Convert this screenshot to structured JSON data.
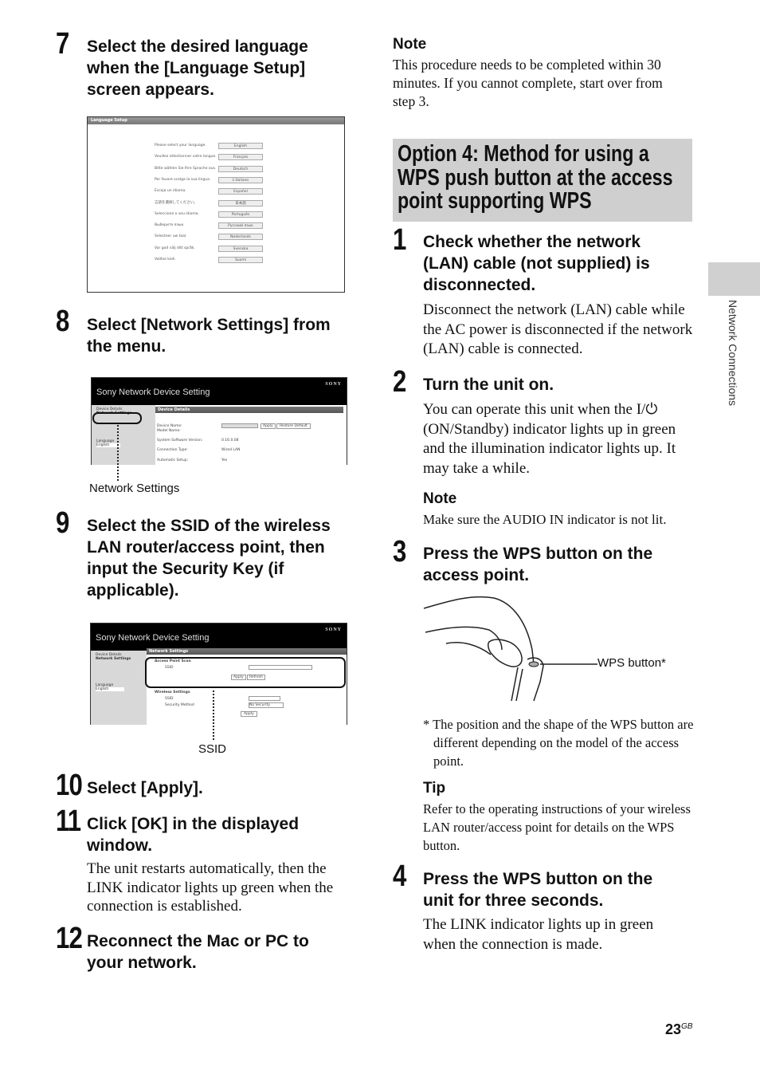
{
  "left": {
    "step7": {
      "num": "7",
      "heading": "Select the desired language when the [Language Setup] screen appears."
    },
    "language_screen": {
      "title": "Language Setup",
      "rows": [
        {
          "prompt": "Please select your language.",
          "button": "English"
        },
        {
          "prompt": "Veuillez sélectionner votre langue.",
          "button": "Français"
        },
        {
          "prompt": "Bitte wählen Sie Ihre Sprache aus.",
          "button": "Deutsch"
        },
        {
          "prompt": "Per favore scelga la sua lingua.",
          "button": "L'italiano"
        },
        {
          "prompt": "Escoja un idioma.",
          "button": "Español"
        },
        {
          "prompt": "言語を選択してください。",
          "button": "日本語"
        },
        {
          "prompt": "Seleccione o seu idioma.",
          "button": "Português"
        },
        {
          "prompt": "Выберите язык.",
          "button": "Русский язык"
        },
        {
          "prompt": "Selecteer uw taal.",
          "button": "Nederlands"
        },
        {
          "prompt": "Var god välj ditt språk.",
          "button": "Svenska"
        },
        {
          "prompt": "Valitse kieli.",
          "button": "Suomi"
        }
      ]
    },
    "step8": {
      "num": "8",
      "heading": "Select [Network Settings] from the menu."
    },
    "device_screen": {
      "title": "Sony Network Device Setting",
      "logo": "SONY",
      "menu_device": "Device Details",
      "menu_network": "Network Settings",
      "language_label": "Language",
      "language_value": "English",
      "section": "Device Details",
      "fields": [
        "Device Name:",
        "Model Name:",
        "System Software Version:",
        "Connection Type:",
        "Automatic Setup:"
      ],
      "values": [
        "",
        "",
        "0.16.0.08",
        "Wired LAN",
        "Yes"
      ],
      "apply": "Apply",
      "restore": "Restore Default"
    },
    "callout_network": "Network Settings",
    "step9": {
      "num": "9",
      "heading": "Select the SSID of the wireless LAN router/access point, then input the Security Key (if applicable)."
    },
    "network_screen": {
      "title": "Sony Network Device Setting",
      "logo": "SONY",
      "menu_device": "Device Details",
      "menu_network": "Network Settings",
      "language_label": "Language",
      "language_value": "English",
      "section": "Network Settings",
      "scan_legend": "Access Point Scan",
      "ssid": "SSID",
      "apply": "Apply",
      "refresh": "Refresh",
      "wireless_legend": "Wireless Settings",
      "security": "Security Method",
      "security_value": "No Security"
    },
    "callout_ssid": "SSID",
    "step10": {
      "num": "10",
      "heading": "Select [Apply]."
    },
    "step11": {
      "num": "11",
      "heading": "Click [OK] in the displayed window.",
      "body": "The unit restarts automatically, then the LINK indicator lights up green when the connection is established."
    },
    "step12": {
      "num": "12",
      "heading": "Reconnect the Mac or PC to your network."
    }
  },
  "right": {
    "note1": {
      "title": "Note",
      "body": "This procedure needs to be completed within 30 minutes. If you cannot complete, start over from step 3."
    },
    "option_title": "Option 4: Method for using a WPS push button at the access point supporting WPS",
    "step1": {
      "num": "1",
      "heading": "Check whether the network (LAN) cable (not supplied) is disconnected.",
      "body": "Disconnect the network (LAN) cable while the AC power is disconnected if the network (LAN) cable is connected."
    },
    "step2": {
      "num": "2",
      "heading": "Turn the unit on.",
      "body": "You can operate this unit when the I/⏻ (ON/Standby) indicator lights up in green and the illumination indicator lights up. It may take a while."
    },
    "note2": {
      "title": "Note",
      "body": "Make sure the AUDIO IN indicator is not lit."
    },
    "step3": {
      "num": "3",
      "heading": "Press the WPS button on the access point."
    },
    "wps_label": "WPS button*",
    "footnote": "* The position and the shape of the WPS button are different depending on the model of the access point.",
    "tip": {
      "title": "Tip",
      "body": "Refer to the operating instructions of your wireless LAN router/access point for details on the WPS button."
    },
    "step4": {
      "num": "4",
      "heading": "Press the WPS button on the unit for three seconds.",
      "body": "The LINK indicator lights up in green when the connection is made."
    }
  },
  "side_tab": "Network Connections",
  "page": {
    "number": "23",
    "suffix": "GB"
  }
}
